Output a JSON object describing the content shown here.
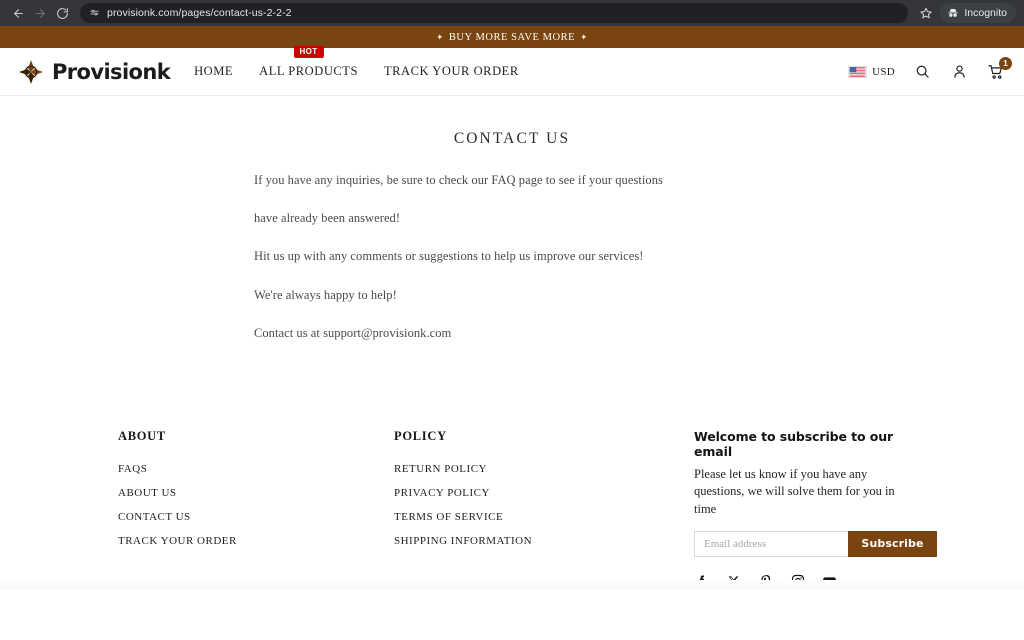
{
  "browser": {
    "back_icon": "arrow-left-icon",
    "forward_icon": "arrow-right-icon",
    "reload_icon": "reload-icon",
    "site_info_icon": "site-settings-icon",
    "url": "provisionk.com/pages/contact-us-2-2-2",
    "bookmark_icon": "star-icon",
    "incognito_label": "Incognito",
    "incognito_icon": "incognito-icon"
  },
  "announcement": {
    "left_spark": "✦",
    "text": "BUY MORE SAVE MORE",
    "right_spark": "✦",
    "background": "#7a4410"
  },
  "header": {
    "brand": {
      "mark_icon": "compass-diamond-logo-icon",
      "name": "Provisionk"
    },
    "nav": [
      {
        "label": "HOME",
        "badge": null
      },
      {
        "label": "ALL PRODUCTS",
        "badge": "HOT"
      },
      {
        "label": "TRACK YOUR ORDER",
        "badge": null
      }
    ],
    "currency": {
      "flag_icon": "us-flag-icon",
      "code": "USD"
    },
    "search_icon": "search-icon",
    "account_icon": "account-person-icon",
    "cart_icon": "shopping-cart-icon",
    "cart_count": "1",
    "badge_color": "#cc0000",
    "cart_badge_color": "#7a4410"
  },
  "main": {
    "title": "CONTACT US",
    "paragraphs": [
      "If you have any inquiries, be sure to check our FAQ page to see if your questions",
      "have already been answered!",
      "Hit us up with any comments or suggestions to help us improve our services!",
      "We're always happy to help!",
      "Contact us at support@provisionk.com"
    ]
  },
  "footer": {
    "about": {
      "title": "ABOUT",
      "links": [
        "FAQS",
        "ABOUT US",
        "CONTACT US",
        "TRACK YOUR ORDER"
      ]
    },
    "policy": {
      "title": "POLICY",
      "links": [
        "RETURN POLICY",
        "PRIVACY POLICY",
        "TERMS OF SERVICE",
        "SHIPPING INFORMATION"
      ]
    },
    "newsletter": {
      "title": "Welcome to subscribe to our email",
      "description": "Please let us know if you have any questions, we will solve them for you in time",
      "email_placeholder": "Email address",
      "email_value": "",
      "subscribe_label": "Subscribe",
      "button_color": "#7a4410"
    },
    "social": [
      {
        "name": "facebook-icon"
      },
      {
        "name": "x-twitter-icon"
      },
      {
        "name": "pinterest-icon"
      },
      {
        "name": "instagram-icon"
      },
      {
        "name": "youtube-icon"
      }
    ]
  }
}
